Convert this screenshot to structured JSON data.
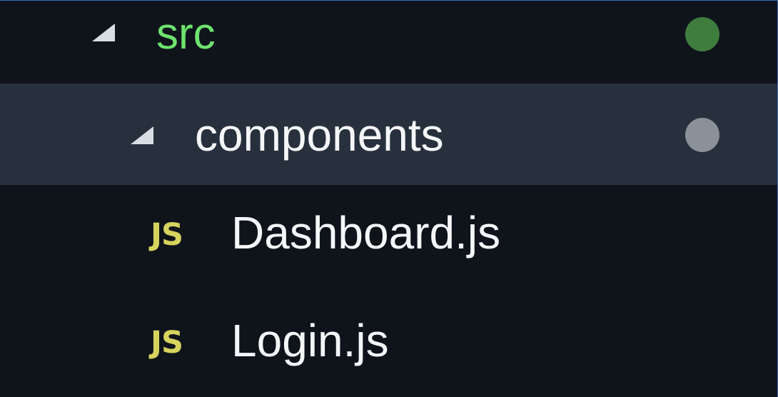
{
  "tree": {
    "src": {
      "label": "src",
      "icon": "chevron-down-icon",
      "label_color": "#6ee36e",
      "status_color": "#3f7d3f"
    },
    "components": {
      "label": "components",
      "icon": "chevron-down-icon",
      "status_color": "#8b9199",
      "selected": true
    },
    "files": [
      {
        "icon_text": "JS",
        "icon": "javascript-file-icon",
        "name": "Dashboard.js"
      },
      {
        "icon_text": "JS",
        "icon": "javascript-file-icon",
        "name": "Login.js"
      }
    ]
  }
}
